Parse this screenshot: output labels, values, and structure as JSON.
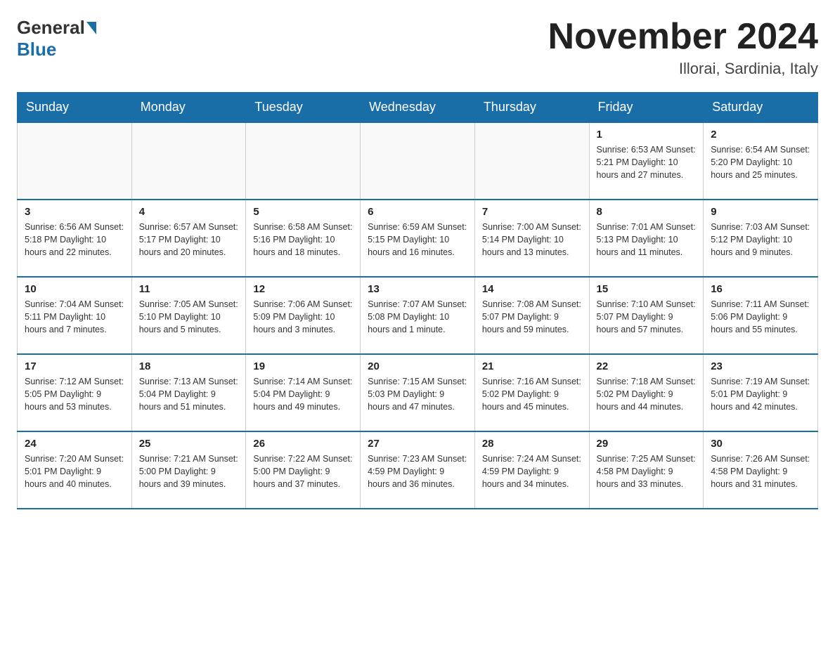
{
  "header": {
    "logo_general": "General",
    "logo_blue": "Blue",
    "month_title": "November 2024",
    "location": "Illorai, Sardinia, Italy"
  },
  "days_of_week": [
    "Sunday",
    "Monday",
    "Tuesday",
    "Wednesday",
    "Thursday",
    "Friday",
    "Saturday"
  ],
  "weeks": [
    [
      {
        "day": "",
        "info": ""
      },
      {
        "day": "",
        "info": ""
      },
      {
        "day": "",
        "info": ""
      },
      {
        "day": "",
        "info": ""
      },
      {
        "day": "",
        "info": ""
      },
      {
        "day": "1",
        "info": "Sunrise: 6:53 AM\nSunset: 5:21 PM\nDaylight: 10 hours and 27 minutes."
      },
      {
        "day": "2",
        "info": "Sunrise: 6:54 AM\nSunset: 5:20 PM\nDaylight: 10 hours and 25 minutes."
      }
    ],
    [
      {
        "day": "3",
        "info": "Sunrise: 6:56 AM\nSunset: 5:18 PM\nDaylight: 10 hours and 22 minutes."
      },
      {
        "day": "4",
        "info": "Sunrise: 6:57 AM\nSunset: 5:17 PM\nDaylight: 10 hours and 20 minutes."
      },
      {
        "day": "5",
        "info": "Sunrise: 6:58 AM\nSunset: 5:16 PM\nDaylight: 10 hours and 18 minutes."
      },
      {
        "day": "6",
        "info": "Sunrise: 6:59 AM\nSunset: 5:15 PM\nDaylight: 10 hours and 16 minutes."
      },
      {
        "day": "7",
        "info": "Sunrise: 7:00 AM\nSunset: 5:14 PM\nDaylight: 10 hours and 13 minutes."
      },
      {
        "day": "8",
        "info": "Sunrise: 7:01 AM\nSunset: 5:13 PM\nDaylight: 10 hours and 11 minutes."
      },
      {
        "day": "9",
        "info": "Sunrise: 7:03 AM\nSunset: 5:12 PM\nDaylight: 10 hours and 9 minutes."
      }
    ],
    [
      {
        "day": "10",
        "info": "Sunrise: 7:04 AM\nSunset: 5:11 PM\nDaylight: 10 hours and 7 minutes."
      },
      {
        "day": "11",
        "info": "Sunrise: 7:05 AM\nSunset: 5:10 PM\nDaylight: 10 hours and 5 minutes."
      },
      {
        "day": "12",
        "info": "Sunrise: 7:06 AM\nSunset: 5:09 PM\nDaylight: 10 hours and 3 minutes."
      },
      {
        "day": "13",
        "info": "Sunrise: 7:07 AM\nSunset: 5:08 PM\nDaylight: 10 hours and 1 minute."
      },
      {
        "day": "14",
        "info": "Sunrise: 7:08 AM\nSunset: 5:07 PM\nDaylight: 9 hours and 59 minutes."
      },
      {
        "day": "15",
        "info": "Sunrise: 7:10 AM\nSunset: 5:07 PM\nDaylight: 9 hours and 57 minutes."
      },
      {
        "day": "16",
        "info": "Sunrise: 7:11 AM\nSunset: 5:06 PM\nDaylight: 9 hours and 55 minutes."
      }
    ],
    [
      {
        "day": "17",
        "info": "Sunrise: 7:12 AM\nSunset: 5:05 PM\nDaylight: 9 hours and 53 minutes."
      },
      {
        "day": "18",
        "info": "Sunrise: 7:13 AM\nSunset: 5:04 PM\nDaylight: 9 hours and 51 minutes."
      },
      {
        "day": "19",
        "info": "Sunrise: 7:14 AM\nSunset: 5:04 PM\nDaylight: 9 hours and 49 minutes."
      },
      {
        "day": "20",
        "info": "Sunrise: 7:15 AM\nSunset: 5:03 PM\nDaylight: 9 hours and 47 minutes."
      },
      {
        "day": "21",
        "info": "Sunrise: 7:16 AM\nSunset: 5:02 PM\nDaylight: 9 hours and 45 minutes."
      },
      {
        "day": "22",
        "info": "Sunrise: 7:18 AM\nSunset: 5:02 PM\nDaylight: 9 hours and 44 minutes."
      },
      {
        "day": "23",
        "info": "Sunrise: 7:19 AM\nSunset: 5:01 PM\nDaylight: 9 hours and 42 minutes."
      }
    ],
    [
      {
        "day": "24",
        "info": "Sunrise: 7:20 AM\nSunset: 5:01 PM\nDaylight: 9 hours and 40 minutes."
      },
      {
        "day": "25",
        "info": "Sunrise: 7:21 AM\nSunset: 5:00 PM\nDaylight: 9 hours and 39 minutes."
      },
      {
        "day": "26",
        "info": "Sunrise: 7:22 AM\nSunset: 5:00 PM\nDaylight: 9 hours and 37 minutes."
      },
      {
        "day": "27",
        "info": "Sunrise: 7:23 AM\nSunset: 4:59 PM\nDaylight: 9 hours and 36 minutes."
      },
      {
        "day": "28",
        "info": "Sunrise: 7:24 AM\nSunset: 4:59 PM\nDaylight: 9 hours and 34 minutes."
      },
      {
        "day": "29",
        "info": "Sunrise: 7:25 AM\nSunset: 4:58 PM\nDaylight: 9 hours and 33 minutes."
      },
      {
        "day": "30",
        "info": "Sunrise: 7:26 AM\nSunset: 4:58 PM\nDaylight: 9 hours and 31 minutes."
      }
    ]
  ]
}
